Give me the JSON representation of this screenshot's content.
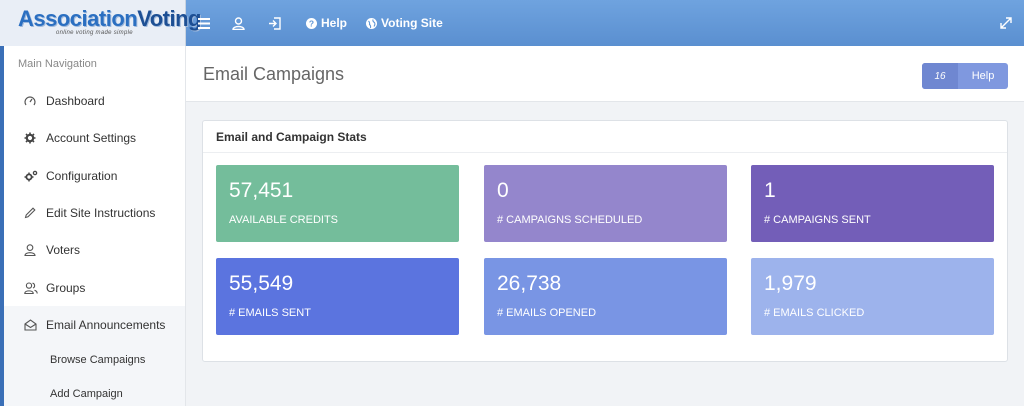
{
  "app": {
    "brand_part1": "Association",
    "brand_part2": "Voting",
    "tagline": "online voting made simple"
  },
  "topbar": {
    "items": [
      {
        "icon": "hamburger-menu-icon"
      },
      {
        "icon": "user-icon"
      },
      {
        "icon": "sign-out-icon"
      },
      {
        "icon": "question-circle-icon",
        "label": "Help"
      },
      {
        "icon": "globe-icon",
        "label": "Voting Site"
      }
    ],
    "expand_icon": "expand-icon"
  },
  "sidebar": {
    "heading": "Main Navigation",
    "items": [
      {
        "label": "Dashboard",
        "icon": "dashboard-icon"
      },
      {
        "label": "Account Settings",
        "icon": "cog-icon"
      },
      {
        "label": "Configuration",
        "icon": "cogs-icon"
      },
      {
        "label": "Edit Site Instructions",
        "icon": "pencil-icon"
      },
      {
        "label": "Voters",
        "icon": "user-icon"
      },
      {
        "label": "Groups",
        "icon": "users-icon"
      },
      {
        "label": "Email Announcements",
        "icon": "envelope-open-icon"
      }
    ],
    "subitems": [
      {
        "label": "Browse Campaigns"
      },
      {
        "label": "Add Campaign"
      }
    ]
  },
  "header": {
    "title": "Email Campaigns",
    "help_count": "16",
    "help_label": "Help"
  },
  "stats_panel": {
    "title": "Email and Campaign Stats",
    "cards": [
      {
        "value": "57,451",
        "label": "AVAILABLE CREDITS",
        "color": "#74bd9b"
      },
      {
        "value": "0",
        "label": "# CAMPAIGNS SCHEDULED",
        "color": "#9486cc"
      },
      {
        "value": "1",
        "label": "# CAMPAIGNS SENT",
        "color": "#735eb8"
      },
      {
        "value": "55,549",
        "label": "# EMAILS SENT",
        "color": "#5b74df"
      },
      {
        "value": "26,738",
        "label": "# EMAILS OPENED",
        "color": "#7995e4"
      },
      {
        "value": "1,979",
        "label": "# EMAILS CLICKED",
        "color": "#9db3ec"
      }
    ]
  }
}
